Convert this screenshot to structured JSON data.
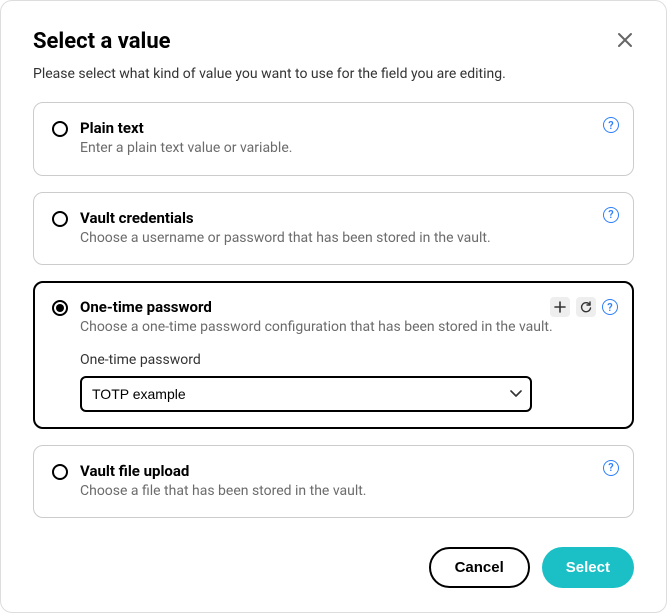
{
  "modal": {
    "title": "Select a value",
    "description": "Please select what kind of value you want to use for the field you are editing."
  },
  "options": {
    "plain_text": {
      "title": "Plain text",
      "desc": "Enter a plain text value or variable."
    },
    "vault_credentials": {
      "title": "Vault credentials",
      "desc": "Choose a username or password that has been stored in the vault."
    },
    "otp": {
      "title": "One-time password",
      "desc": "Choose a one-time password configuration that has been stored in the vault.",
      "field_label": "One-time password",
      "selected_value": "TOTP example"
    },
    "vault_file_upload": {
      "title": "Vault file upload",
      "desc": "Choose a file that has been stored in the vault."
    }
  },
  "buttons": {
    "cancel": "Cancel",
    "select": "Select"
  }
}
